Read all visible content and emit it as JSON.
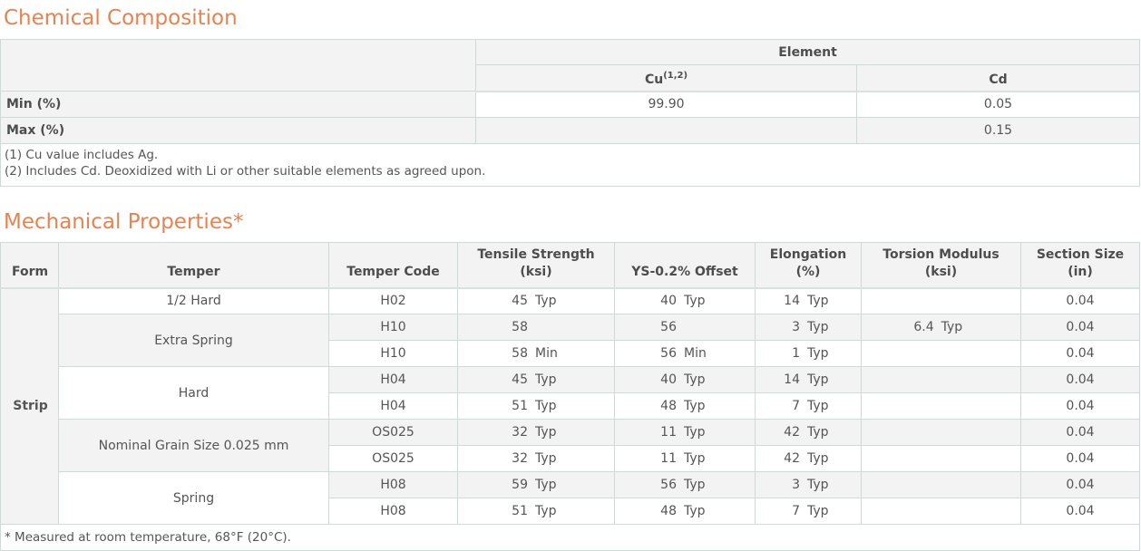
{
  "chemical": {
    "title": "Chemical Composition",
    "group_header": "Element",
    "columns": [
      {
        "symbol": "Cu",
        "sup": "(1,2)"
      },
      {
        "symbol": "Cd",
        "sup": ""
      }
    ],
    "rows": [
      {
        "label": "Min (%)",
        "values": [
          "99.90",
          "0.05"
        ]
      },
      {
        "label": "Max (%)",
        "values": [
          "",
          "0.15"
        ]
      }
    ],
    "notes": [
      "(1) Cu value includes Ag.",
      "(2) Includes Cd. Deoxidized with Li or other suitable elements as agreed upon."
    ]
  },
  "mechanical": {
    "title": "Mechanical Properties*",
    "headers": {
      "form": "Form",
      "temper": "Temper",
      "temper_code": "Temper Code",
      "tensile_1": "Tensile Strength",
      "tensile_2": "(ksi)",
      "ys": "YS-0.2% Offset",
      "elong_1": "Elongation",
      "elong_2": "(%)",
      "torsion_1": "Torsion Modulus",
      "torsion_2": "(ksi)",
      "section_1": "Section Size",
      "section_2": "(in)"
    },
    "form": "Strip",
    "tempers": [
      "1/2 Hard",
      "Extra Spring",
      "Hard",
      "Nominal Grain Size 0.025 mm",
      "Spring"
    ],
    "rows": [
      {
        "code": "H02",
        "tensile": "45",
        "tensile_q": "Typ",
        "ys": "40",
        "ys_q": "Typ",
        "elong": "14",
        "elong_q": "Typ",
        "torsion": "",
        "torsion_q": "",
        "section": "0.04"
      },
      {
        "code": "H10",
        "tensile": "58",
        "tensile_q": "",
        "ys": "56",
        "ys_q": "",
        "elong": "3",
        "elong_q": "Typ",
        "torsion": "6.4",
        "torsion_q": "Typ",
        "section": "0.04"
      },
      {
        "code": "H10",
        "tensile": "58",
        "tensile_q": "Min",
        "ys": "56",
        "ys_q": "Min",
        "elong": "1",
        "elong_q": "Typ",
        "torsion": "",
        "torsion_q": "",
        "section": "0.04"
      },
      {
        "code": "H04",
        "tensile": "45",
        "tensile_q": "Typ",
        "ys": "40",
        "ys_q": "Typ",
        "elong": "14",
        "elong_q": "Typ",
        "torsion": "",
        "torsion_q": "",
        "section": "0.04"
      },
      {
        "code": "H04",
        "tensile": "51",
        "tensile_q": "Typ",
        "ys": "48",
        "ys_q": "Typ",
        "elong": "7",
        "elong_q": "Typ",
        "torsion": "",
        "torsion_q": "",
        "section": "0.04"
      },
      {
        "code": "OS025",
        "tensile": "32",
        "tensile_q": "Typ",
        "ys": "11",
        "ys_q": "Typ",
        "elong": "42",
        "elong_q": "Typ",
        "torsion": "",
        "torsion_q": "",
        "section": "0.04"
      },
      {
        "code": "OS025",
        "tensile": "32",
        "tensile_q": "Typ",
        "ys": "11",
        "ys_q": "Typ",
        "elong": "42",
        "elong_q": "Typ",
        "torsion": "",
        "torsion_q": "",
        "section": "0.04"
      },
      {
        "code": "H08",
        "tensile": "59",
        "tensile_q": "Typ",
        "ys": "56",
        "ys_q": "Typ",
        "elong": "3",
        "elong_q": "Typ",
        "torsion": "",
        "torsion_q": "",
        "section": "0.04"
      },
      {
        "code": "H08",
        "tensile": "51",
        "tensile_q": "Typ",
        "ys": "48",
        "ys_q": "Typ",
        "elong": "7",
        "elong_q": "Typ",
        "torsion": "",
        "torsion_q": "",
        "section": "0.04"
      }
    ],
    "footnote": "* Measured at room temperature, 68°F (20°C)."
  },
  "colors": {
    "heading": "#e88350",
    "header_bg": "#f3f3f3",
    "border": "#cbdbd7"
  }
}
